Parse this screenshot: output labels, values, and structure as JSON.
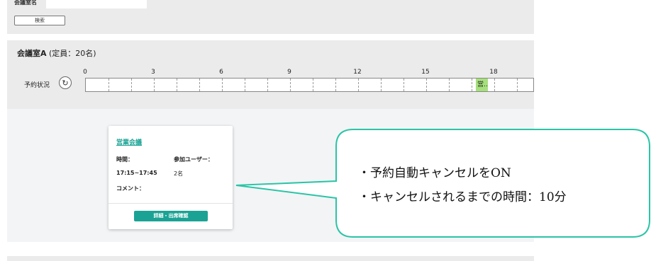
{
  "search": {
    "room_label": "会議室名",
    "room_input_value": "",
    "search_button": "検索"
  },
  "room": {
    "name": "会議室A",
    "capacity": "(定員：20名)",
    "status_label": "予約状況",
    "ticks": [
      "0",
      "3",
      "6",
      "9",
      "12",
      "15",
      "18"
    ],
    "booking_label": "営…",
    "booking_color": "#a6e07c"
  },
  "card": {
    "title": "営業会議",
    "time_label": "時間：",
    "time_value": "17:15~17:45",
    "users_label": "参加ユーザー：",
    "users_value": "2名",
    "comment_label": "コメント：",
    "button_label": "詳細・出席確認",
    "accent_color": "#1aa394"
  },
  "callout": {
    "line1": "・予約自動キャンセルをON",
    "line2": "・キャンセルされるまでの時間：10分",
    "border_color": "#2bc4a6"
  }
}
